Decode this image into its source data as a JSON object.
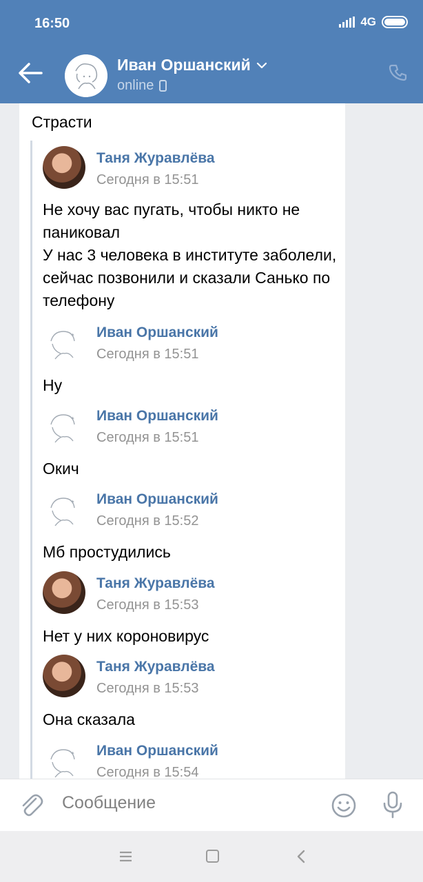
{
  "status_bar": {
    "time": "16:50",
    "network": "4G"
  },
  "header": {
    "contact_name": "Иван Оршанский",
    "status": "online"
  },
  "message": {
    "text": "Страсти",
    "forwarded": [
      {
        "author": "Таня Журавлёва",
        "time": "Сегодня в 15:51",
        "text": "Не хочу вас пугать, чтобы никто не паниковал\nУ нас 3 человека в институте заболели, сейчас позвонили и сказали Санько по телефону"
      },
      {
        "author": "Иван Оршанский",
        "time": "Сегодня в 15:51",
        "text": "Ну"
      },
      {
        "author": "Иван Оршанский",
        "time": "Сегодня в 15:51",
        "text": "Окич"
      },
      {
        "author": "Иван Оршанский",
        "time": "Сегодня в 15:52",
        "text": "Мб простудились"
      },
      {
        "author": "Таня Журавлёва",
        "time": "Сегодня в 15:53",
        "text": "Нет у них короновирус"
      },
      {
        "author": "Таня Журавлёва",
        "time": "Сегодня в 15:53",
        "text": "Она сказала"
      },
      {
        "author": "Иван Оршанский",
        "time": "Сегодня в 15:54",
        "text": ""
      }
    ]
  },
  "composer": {
    "placeholder": "Сообщение"
  },
  "colors": {
    "header_bg": "#5181b8",
    "link": "#4a76a8",
    "meta": "#939393"
  },
  "icons": {
    "back": "arrow-left-icon",
    "phone": "phone-icon",
    "attach": "paperclip-icon",
    "emoji": "smile-icon",
    "mic": "microphone-icon"
  }
}
